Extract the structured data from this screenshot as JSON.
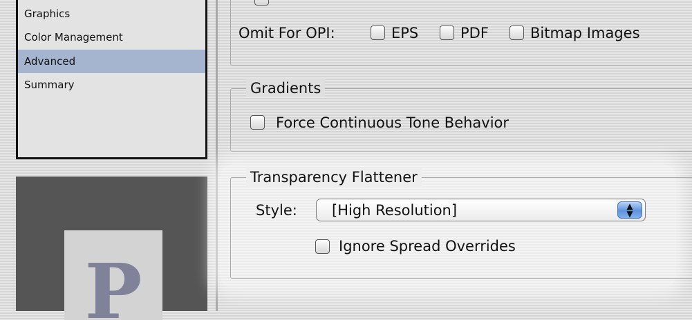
{
  "sidebar": {
    "items": [
      {
        "label": "Graphics",
        "selected": false
      },
      {
        "label": "Color Management",
        "selected": false
      },
      {
        "label": "Advanced",
        "selected": true
      },
      {
        "label": "Summary",
        "selected": false
      }
    ]
  },
  "preview": {
    "letter": "P"
  },
  "omit_opi": {
    "label": "Omit For OPI:",
    "options": [
      {
        "label": "EPS",
        "checked": false
      },
      {
        "label": "PDF",
        "checked": false
      },
      {
        "label": "Bitmap Images",
        "checked": false
      }
    ]
  },
  "gradients": {
    "title": "Gradients",
    "force_continuous_tone": {
      "label": "Force Continuous Tone Behavior",
      "checked": false
    }
  },
  "transparency_flattener": {
    "title": "Transparency Flattener",
    "style_label": "Style:",
    "style_value": "[High Resolution]",
    "ignore_spread_overrides": {
      "label": "Ignore Spread Overrides",
      "checked": false
    }
  },
  "colors": {
    "selection": "#a6b5cf",
    "preview_bg": "#555555",
    "accent_blue": "#5f93da"
  },
  "icons": [
    "popup-arrows-icon"
  ]
}
